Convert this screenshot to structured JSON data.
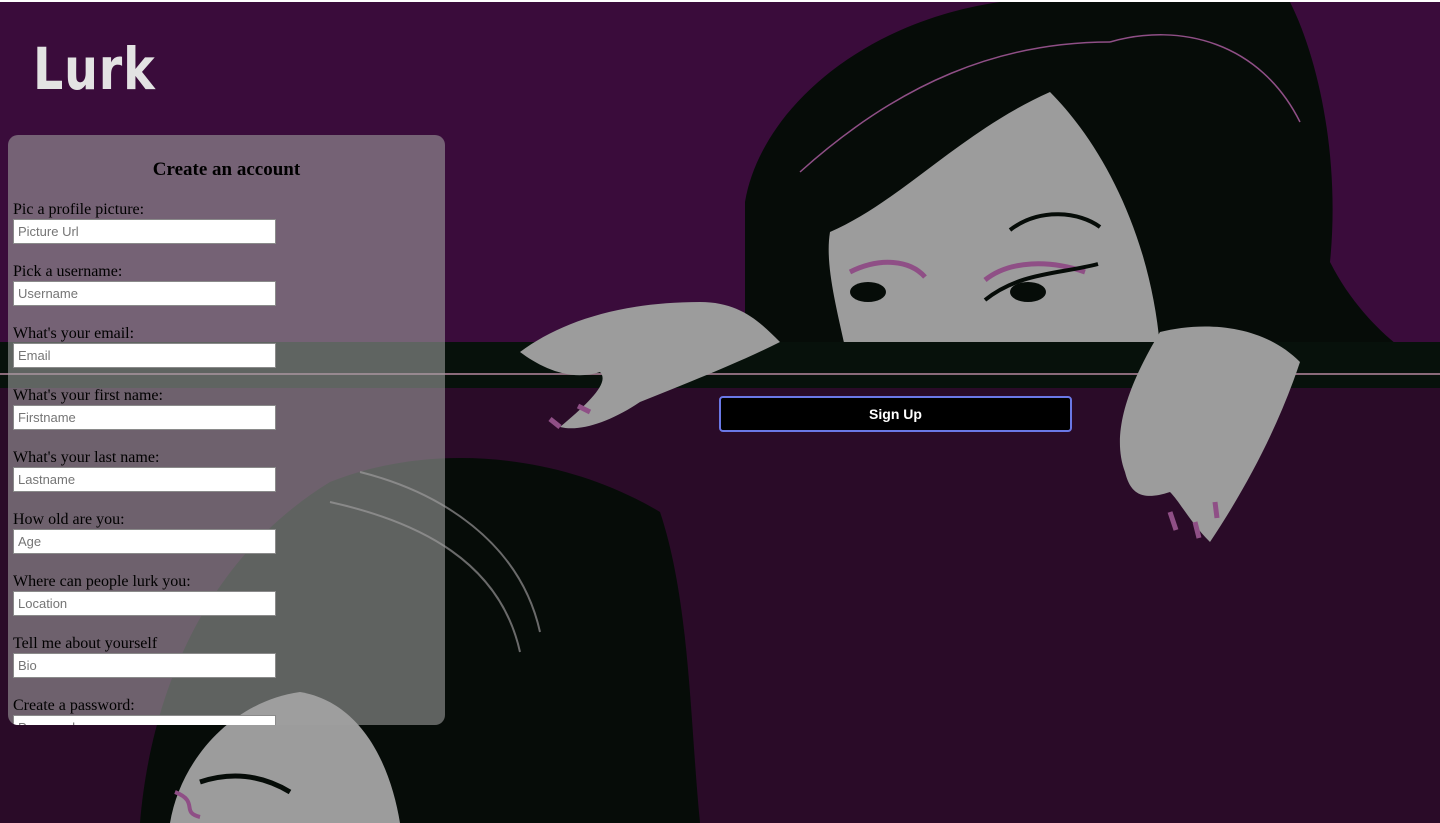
{
  "app": {
    "logo_text": "Lurk"
  },
  "form": {
    "title": "Create an account",
    "fields": [
      {
        "label": "Pic a profile picture:",
        "placeholder": "Picture Url",
        "value": ""
      },
      {
        "label": "Pick a username:",
        "placeholder": "Username",
        "value": ""
      },
      {
        "label": "What's your email:",
        "placeholder": "Email",
        "value": ""
      },
      {
        "label": "What's your first name:",
        "placeholder": "Firstname",
        "value": ""
      },
      {
        "label": "What's your last name:",
        "placeholder": "Lastname",
        "value": ""
      },
      {
        "label": "How old are you:",
        "placeholder": "Age",
        "value": ""
      },
      {
        "label": "Where can people lurk you:",
        "placeholder": "Location",
        "value": ""
      },
      {
        "label": "Tell me about yourself",
        "placeholder": "Bio",
        "value": ""
      },
      {
        "label": "Create a password:",
        "placeholder": "Password",
        "value": ""
      }
    ],
    "submit_label": "Sign Up"
  },
  "background": {
    "description_icon": "woman-peeking-illustration",
    "colors": {
      "purple": "#3a0c3b",
      "dark": "#060c08",
      "skin": "#9c9c9c",
      "accent": "#8f4f86"
    }
  }
}
